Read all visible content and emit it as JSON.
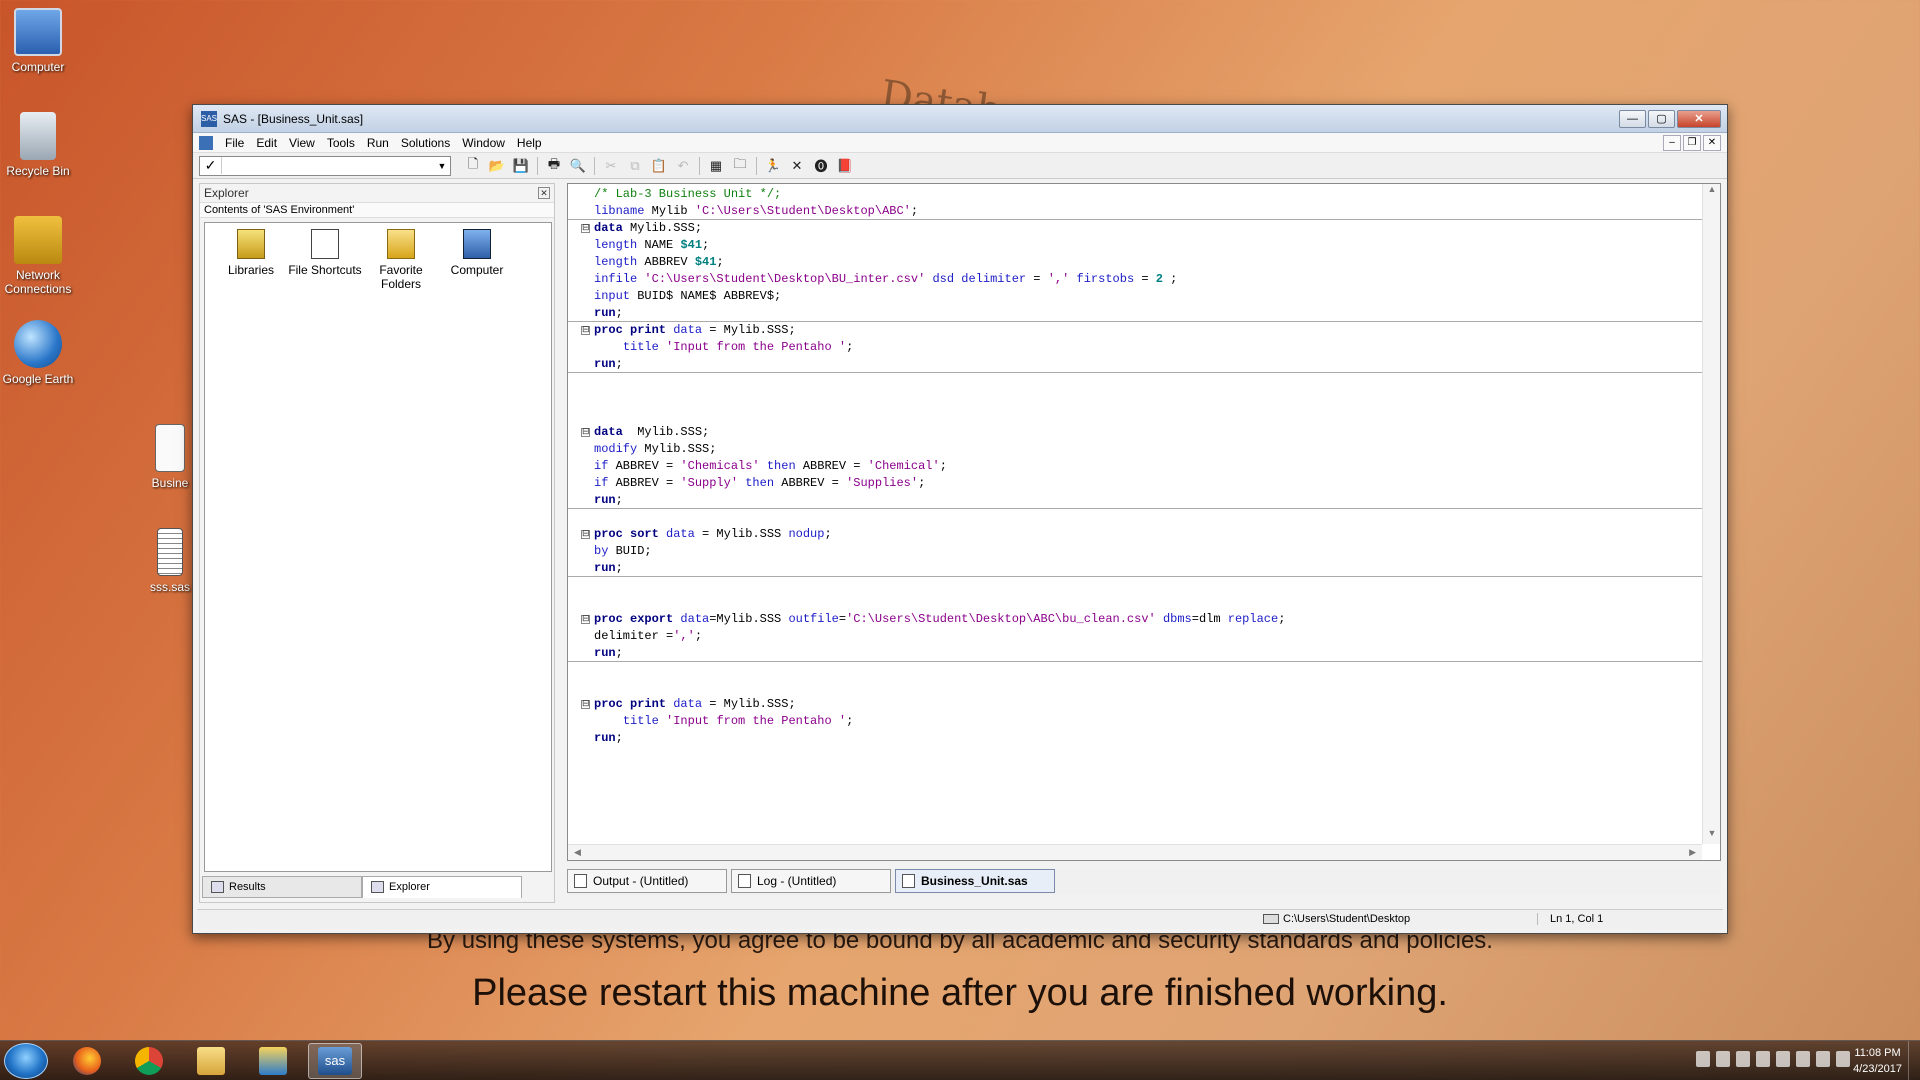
{
  "desktop": {
    "icons": [
      {
        "label": "Computer"
      },
      {
        "label": "Recycle Bin"
      },
      {
        "label": "Network Connections"
      },
      {
        "label": "Google Earth"
      },
      {
        "label": "Busine"
      },
      {
        "label": "sss.sas"
      }
    ],
    "wallpaper_line1": "By using these systems, you agree to be bound by all academic and security standards and policies.",
    "wallpaper_line2": "Please restart this machine after you are finished working.",
    "wallpaper_header": "Database"
  },
  "window": {
    "title": "SAS - [Business_Unit.sas]",
    "app_icon": "SAS",
    "minimize": "—",
    "maximize": "▢",
    "close": "✕"
  },
  "menu": {
    "items": [
      "File",
      "Edit",
      "View",
      "Tools",
      "Run",
      "Solutions",
      "Window",
      "Help"
    ],
    "mdi_minimize": "–",
    "mdi_restore": "❐",
    "mdi_close": "✕"
  },
  "toolbar": {
    "command_check": "✓",
    "command_value": "",
    "dropdown_arrow": "▼",
    "buttons": [
      {
        "name": "new-icon",
        "glyph": "🗋",
        "enabled": true
      },
      {
        "name": "open-icon",
        "glyph": "📂",
        "enabled": true
      },
      {
        "name": "save-icon",
        "glyph": "💾",
        "enabled": true
      },
      {
        "name": "print-icon",
        "glyph": "🖶",
        "enabled": true
      },
      {
        "name": "print-preview-icon",
        "glyph": "🔍",
        "enabled": true
      },
      {
        "name": "cut-icon",
        "glyph": "✂",
        "enabled": false
      },
      {
        "name": "copy-icon",
        "glyph": "⧉",
        "enabled": false
      },
      {
        "name": "paste-icon",
        "glyph": "📋",
        "enabled": false
      },
      {
        "name": "undo-icon",
        "glyph": "↶",
        "enabled": false
      },
      {
        "name": "libraries-icon",
        "glyph": "▦",
        "enabled": true
      },
      {
        "name": "explorer-icon",
        "glyph": "🗀",
        "enabled": true
      },
      {
        "name": "submit-run-icon",
        "glyph": "🏃",
        "enabled": true
      },
      {
        "name": "clear-icon",
        "glyph": "✕",
        "enabled": true
      },
      {
        "name": "break-icon",
        "glyph": "⓿",
        "enabled": true
      },
      {
        "name": "help-book-icon",
        "glyph": "📕",
        "enabled": true
      }
    ]
  },
  "explorer": {
    "title": "Explorer",
    "close": "✕",
    "subtitle": "Contents of 'SAS Environment'",
    "items": [
      {
        "label": "Libraries"
      },
      {
        "label": "File Shortcuts"
      },
      {
        "label": "Favorite Folders"
      },
      {
        "label": "Computer"
      }
    ],
    "tabs": [
      {
        "label": "Results"
      },
      {
        "label": "Explorer"
      }
    ]
  },
  "editor": {
    "lines": [
      {
        "fold": "",
        "tokens": [
          [
            "cmt",
            "/* Lab-3 Business Unit */;"
          ]
        ]
      },
      {
        "fold": "",
        "sep": true,
        "tokens": [
          [
            "kw",
            "libname"
          ],
          [
            "plain",
            " Mylib "
          ],
          [
            "str",
            "'C:\\Users\\Student\\Desktop\\ABC'"
          ],
          [
            "plain",
            ";"
          ]
        ]
      },
      {
        "fold": "⊟",
        "tokens": [
          [
            "kwb",
            "data"
          ],
          [
            "plain",
            " Mylib.SSS;"
          ]
        ]
      },
      {
        "fold": "",
        "tokens": [
          [
            "kw",
            "length"
          ],
          [
            "plain",
            " NAME "
          ],
          [
            "num",
            "$41"
          ],
          [
            "plain",
            ";"
          ]
        ]
      },
      {
        "fold": "",
        "tokens": [
          [
            "kw",
            "length"
          ],
          [
            "plain",
            " ABBREV "
          ],
          [
            "num",
            "$41"
          ],
          [
            "plain",
            ";"
          ]
        ]
      },
      {
        "fold": "",
        "tokens": [
          [
            "kw",
            "infile"
          ],
          [
            "plain",
            " "
          ],
          [
            "str",
            "'C:\\Users\\Student\\Desktop\\BU_inter.csv'"
          ],
          [
            "plain",
            " "
          ],
          [
            "kw",
            "dsd delimiter"
          ],
          [
            "plain",
            " = "
          ],
          [
            "str",
            "','"
          ],
          [
            "plain",
            " "
          ],
          [
            "kw",
            "firstobs"
          ],
          [
            "plain",
            " = "
          ],
          [
            "num",
            "2"
          ],
          [
            "plain",
            " ;"
          ]
        ]
      },
      {
        "fold": "",
        "tokens": [
          [
            "kw",
            "input"
          ],
          [
            "plain",
            " BUID$ NAME$ ABBREV$;"
          ]
        ]
      },
      {
        "fold": "",
        "sep": true,
        "tokens": [
          [
            "kwb",
            "run"
          ],
          [
            "plain",
            ";"
          ]
        ]
      },
      {
        "fold": "⊟",
        "tokens": [
          [
            "kwb",
            "proc print"
          ],
          [
            "plain",
            " "
          ],
          [
            "kw",
            "data"
          ],
          [
            "plain",
            " = Mylib.SSS;"
          ]
        ]
      },
      {
        "fold": "",
        "tokens": [
          [
            "plain",
            "    "
          ],
          [
            "kw",
            "title"
          ],
          [
            "plain",
            " "
          ],
          [
            "str",
            "'Input from the Pentaho '"
          ],
          [
            "plain",
            ";"
          ]
        ]
      },
      {
        "fold": "",
        "sep": true,
        "tokens": [
          [
            "kwb",
            "run"
          ],
          [
            "plain",
            ";"
          ]
        ]
      },
      {
        "fold": "",
        "tokens": []
      },
      {
        "fold": "",
        "tokens": []
      },
      {
        "fold": "",
        "tokens": []
      },
      {
        "fold": "⊟",
        "tokens": [
          [
            "kwb",
            "data"
          ],
          [
            "plain",
            "  Mylib.SSS;"
          ]
        ]
      },
      {
        "fold": "",
        "tokens": [
          [
            "kw",
            "modify"
          ],
          [
            "plain",
            " Mylib.SSS;"
          ]
        ]
      },
      {
        "fold": "",
        "tokens": [
          [
            "kw",
            "if"
          ],
          [
            "plain",
            " ABBREV = "
          ],
          [
            "str",
            "'Chemicals'"
          ],
          [
            "plain",
            " "
          ],
          [
            "kw",
            "then"
          ],
          [
            "plain",
            " ABBREV = "
          ],
          [
            "str",
            "'Chemical'"
          ],
          [
            "plain",
            ";"
          ]
        ]
      },
      {
        "fold": "",
        "tokens": [
          [
            "kw",
            "if"
          ],
          [
            "plain",
            " ABBREV = "
          ],
          [
            "str",
            "'Supply'"
          ],
          [
            "plain",
            " "
          ],
          [
            "kw",
            "then"
          ],
          [
            "plain",
            " ABBREV = "
          ],
          [
            "str",
            "'Supplies'"
          ],
          [
            "plain",
            ";"
          ]
        ]
      },
      {
        "fold": "",
        "sep": true,
        "tokens": [
          [
            "kwb",
            "run"
          ],
          [
            "plain",
            ";"
          ]
        ]
      },
      {
        "fold": "",
        "tokens": []
      },
      {
        "fold": "⊟",
        "tokens": [
          [
            "kwb",
            "proc sort"
          ],
          [
            "plain",
            " "
          ],
          [
            "kw",
            "data"
          ],
          [
            "plain",
            " = Mylib.SSS "
          ],
          [
            "kw",
            "nodup"
          ],
          [
            "plain",
            ";"
          ]
        ]
      },
      {
        "fold": "",
        "tokens": [
          [
            "kw",
            "by"
          ],
          [
            "plain",
            " BUID;"
          ]
        ]
      },
      {
        "fold": "",
        "sep": true,
        "tokens": [
          [
            "kwb",
            "run"
          ],
          [
            "plain",
            ";"
          ]
        ]
      },
      {
        "fold": "",
        "tokens": []
      },
      {
        "fold": "",
        "tokens": []
      },
      {
        "fold": "⊟",
        "tokens": [
          [
            "kwb",
            "proc export"
          ],
          [
            "plain",
            " "
          ],
          [
            "kw",
            "data"
          ],
          [
            "plain",
            "=Mylib.SSS "
          ],
          [
            "kw",
            "outfile"
          ],
          [
            "plain",
            "="
          ],
          [
            "str",
            "'C:\\Users\\Student\\Desktop\\ABC\\bu_clean.csv'"
          ],
          [
            "plain",
            " "
          ],
          [
            "kw",
            "dbms"
          ],
          [
            "plain",
            "=dlm "
          ],
          [
            "kw",
            "replace"
          ],
          [
            "plain",
            ";"
          ]
        ]
      },
      {
        "fold": "",
        "tokens": [
          [
            "plain",
            "delimiter ="
          ],
          [
            "str",
            "','"
          ],
          [
            "plain",
            ";"
          ]
        ]
      },
      {
        "fold": "",
        "sep": true,
        "tokens": [
          [
            "kwb",
            "run"
          ],
          [
            "plain",
            ";"
          ]
        ]
      },
      {
        "fold": "",
        "tokens": []
      },
      {
        "fold": "",
        "tokens": []
      },
      {
        "fold": "⊟",
        "tokens": [
          [
            "kwb",
            "proc print"
          ],
          [
            "plain",
            " "
          ],
          [
            "kw",
            "data"
          ],
          [
            "plain",
            " = Mylib.SSS;"
          ]
        ]
      },
      {
        "fold": "",
        "tokens": [
          [
            "plain",
            "    "
          ],
          [
            "kw",
            "title"
          ],
          [
            "plain",
            " "
          ],
          [
            "str",
            "'Input from the Pentaho '"
          ],
          [
            "plain",
            ";"
          ]
        ]
      },
      {
        "fold": "",
        "tokens": [
          [
            "kwb",
            "run"
          ],
          [
            "plain",
            ";"
          ]
        ]
      }
    ],
    "scroll_up": "▲",
    "scroll_down": "▼",
    "scroll_left": "◀",
    "scroll_right": "▶"
  },
  "window_tabs": [
    {
      "label": "Output - (Untitled)",
      "active": false
    },
    {
      "label": "Log - (Untitled)",
      "active": false
    },
    {
      "label": "Business_Unit.sas",
      "active": true
    }
  ],
  "status": {
    "path": "C:\\Users\\Student\\Desktop",
    "position": "Ln 1, Col 1"
  },
  "taskbar": {
    "apps": [
      {
        "name": "firefox"
      },
      {
        "name": "chrome"
      },
      {
        "name": "file-explorer"
      },
      {
        "name": "monitor-app"
      },
      {
        "name": "sas",
        "label": "sas",
        "active": true
      }
    ],
    "time": "11:08 PM",
    "date": "4/23/2017"
  }
}
